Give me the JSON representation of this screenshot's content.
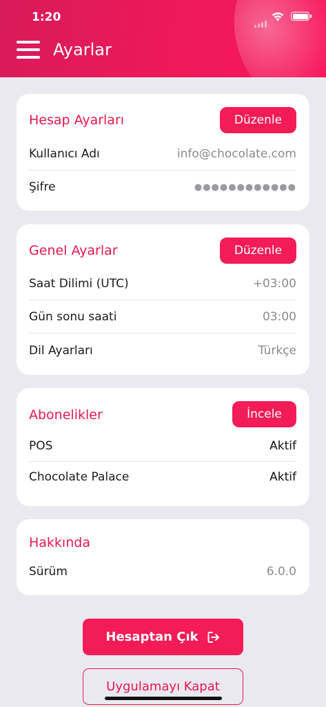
{
  "status_bar": {
    "time": "1:20"
  },
  "header": {
    "title": "Ayarlar"
  },
  "account": {
    "title": "Hesap Ayarları",
    "edit_label": "Düzenle",
    "rows": [
      {
        "label": "Kullanıcı Adı",
        "value": "info@chocolate.com"
      },
      {
        "label": "Şifre",
        "value": "●●●●●●●●●●●●"
      }
    ]
  },
  "general": {
    "title": "Genel Ayarlar",
    "edit_label": "Düzenle",
    "rows": [
      {
        "label": "Saat Dilimi (UTC)",
        "value": "+03:00"
      },
      {
        "label": "Gün sonu saati",
        "value": "03:00"
      },
      {
        "label": "Dil Ayarları",
        "value": "Türkçe"
      }
    ]
  },
  "subscriptions": {
    "title": "Abonelikler",
    "review_label": "İncele",
    "rows": [
      {
        "label": "POS",
        "value": "Aktif"
      },
      {
        "label": "Chocolate Palace",
        "value": "Aktif"
      }
    ]
  },
  "about": {
    "title": "Hakkında",
    "rows": [
      {
        "label": "Sürüm",
        "value": "6.0.0"
      }
    ]
  },
  "actions": {
    "logout_label": "Hesaptan Çık",
    "close_app_label": "Uygulamayı Kapat"
  },
  "colors": {
    "accent": "#f31c56",
    "title_red": "#e5174f",
    "background": "#ebe9f0"
  }
}
